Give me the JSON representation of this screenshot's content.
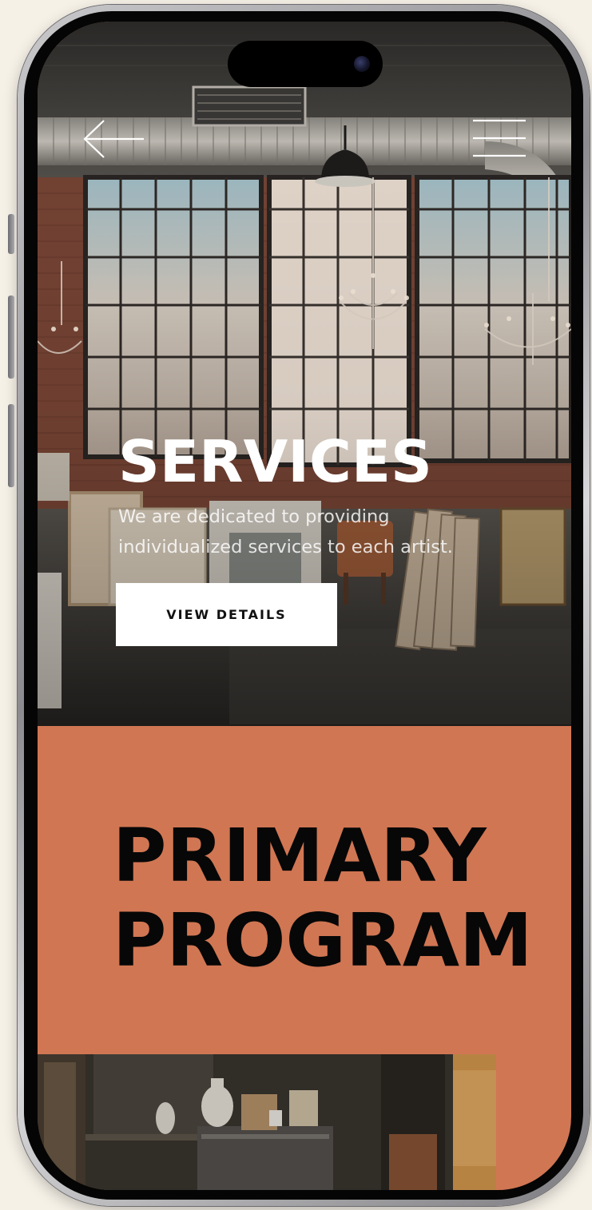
{
  "hero": {
    "title": "SERVICES",
    "subtitle": "We are dedicated to providing individualized services to each artist.",
    "button_label": "VIEW DETAILS"
  },
  "program": {
    "title_line1": "PRIMARY",
    "title_line2": "PROGRAM"
  },
  "icons": {
    "back": "arrow-left-icon",
    "menu": "hamburger-menu-icon"
  },
  "colors": {
    "background": "#f6f1e7",
    "accent": "#d07653",
    "title_text": "#070707",
    "button_bg": "#ffffff"
  }
}
